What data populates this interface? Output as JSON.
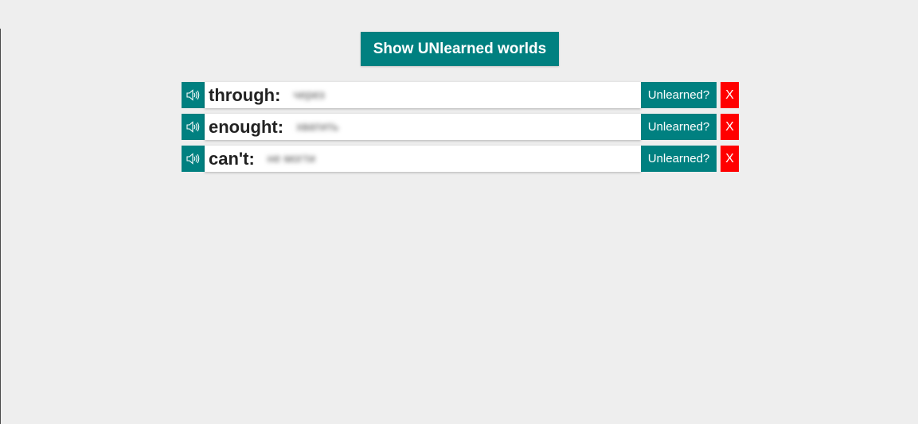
{
  "header": {
    "show_unlearned_label": "Show UNlearned worlds"
  },
  "words": [
    {
      "word": "through:",
      "translation": "через",
      "unlearned_label": "Unlearned?",
      "delete_label": "X"
    },
    {
      "word": "enought:",
      "translation": "хватить",
      "unlearned_label": "Unlearned?",
      "delete_label": "X"
    },
    {
      "word": "can't:",
      "translation": "не могти",
      "unlearned_label": "Unlearned?",
      "delete_label": "X"
    }
  ],
  "icons": {
    "sound": "speaker-icon"
  },
  "colors": {
    "accent": "#008080",
    "danger": "#ff0000",
    "background": "#eeeeee"
  }
}
